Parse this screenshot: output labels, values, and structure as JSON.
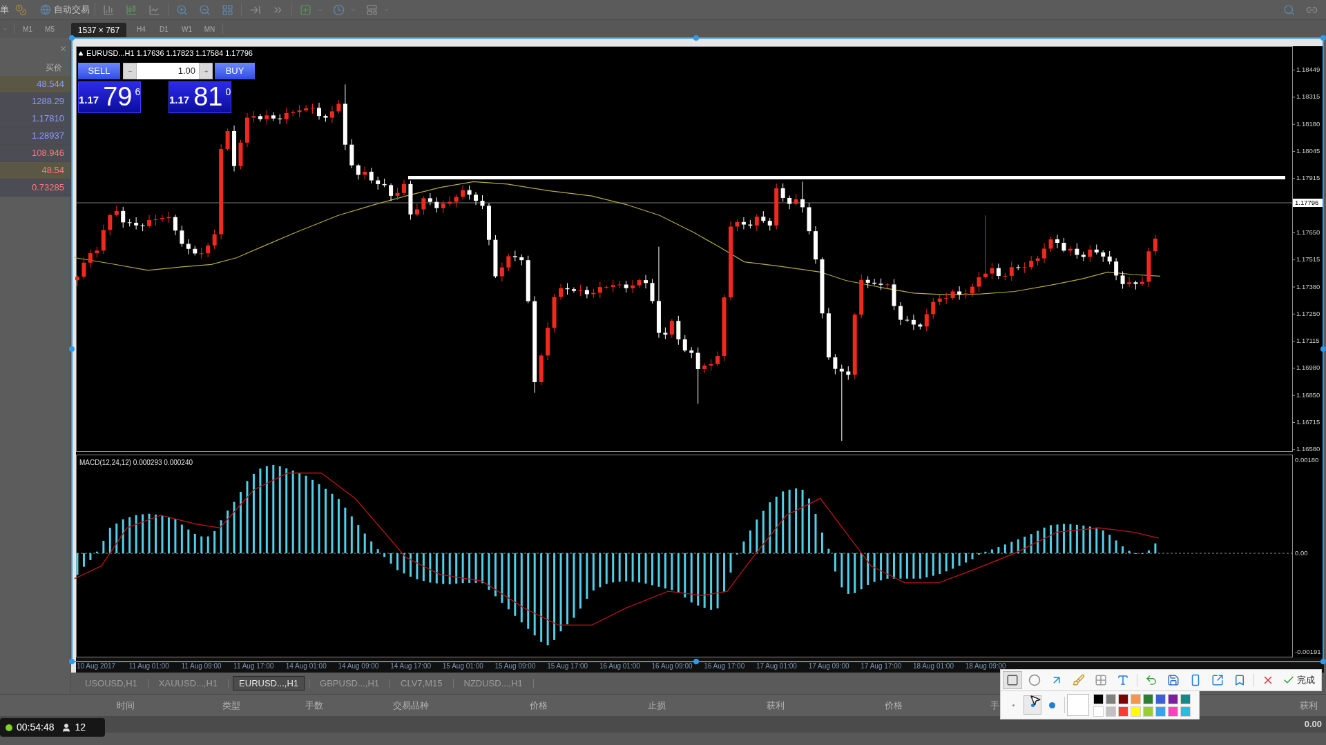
{
  "toolbar": {
    "cut_label": "单",
    "auto_trading": "自动交易"
  },
  "timeframes": [
    "M1",
    "M5",
    "H4",
    "D1",
    "W1",
    "MN"
  ],
  "capture_size": "1537 × 767",
  "market_watch": {
    "header": "买价",
    "rows": [
      {
        "bid": "48.544",
        "color": "#8c9aff",
        "highlighted": true
      },
      {
        "bid": "1288.29",
        "color": "#8c9aff",
        "highlighted": false
      },
      {
        "bid": "1.17810",
        "color": "#8c9aff",
        "highlighted": false
      },
      {
        "bid": "1.28937",
        "color": "#8c9aff",
        "highlighted": false
      },
      {
        "bid": "108.946",
        "color": "#ff7a7a",
        "highlighted": false
      },
      {
        "bid": "48.54",
        "color": "#ff7a7a",
        "highlighted": true
      },
      {
        "bid": "0.73285",
        "color": "#ff7a7a",
        "highlighted": false
      }
    ]
  },
  "chart": {
    "header": "EURUSD...H1 1.17636 1.17823 1.17584 1.17796",
    "trade_panel": {
      "sell": "SELL",
      "lots": "1.00",
      "buy": "BUY",
      "bid": {
        "big": "1.17",
        "pips": "79",
        "point": "6"
      },
      "ask": {
        "big": "1.17",
        "pips": "81",
        "point": "0"
      }
    },
    "price_scale": [
      "1.18449",
      "1.18315",
      "1.18180",
      "1.18045",
      "1.17915",
      "1.17650",
      "1.17515",
      "1.17380",
      "1.17250",
      "1.17115",
      "1.16980",
      "1.16850",
      "1.16715",
      "1.16580"
    ],
    "current_price": "1.17796",
    "indicator": {
      "label": "MACD(12,24,12) 0.000293 0.000240",
      "scale": [
        "0.00180",
        "0.00",
        "-0.00191"
      ]
    },
    "time_labels": [
      "10 Aug 2017",
      "11 Aug 01:00",
      "11 Aug 09:00",
      "11 Aug 17:00",
      "14 Aug 01:00",
      "14 Aug 09:00",
      "14 Aug 17:00",
      "15 Aug 01:00",
      "15 Aug 09:00",
      "15 Aug 17:00",
      "16 Aug 01:00",
      "16 Aug 09:00",
      "16 Aug 17:00",
      "17 Aug 01:00",
      "17 Aug 09:00",
      "17 Aug 17:00",
      "18 Aug 01:00",
      "18 Aug 09:00"
    ]
  },
  "chart_tabs": [
    {
      "label": "USOUSD,H1",
      "selected": false
    },
    {
      "label": "XAUUSD...,H1",
      "selected": false
    },
    {
      "label": "EURUSD...,H1",
      "selected": true
    },
    {
      "label": "GBPUSD...,H1",
      "selected": false
    },
    {
      "label": "CLV7,M15",
      "selected": false
    },
    {
      "label": "NZDUSD...,H1",
      "selected": false
    }
  ],
  "terminal": {
    "columns": [
      "时间",
      "类型",
      "手数",
      "交易品种",
      "价格",
      "止损",
      "获利",
      "价格",
      "手",
      "获利"
    ],
    "total": "0.00"
  },
  "recording": {
    "elapsed": "00:54:48",
    "viewers": "12"
  },
  "capture_toolbar": {
    "draw_tools": [
      {
        "kind": "rectangle",
        "selected": true
      },
      {
        "kind": "ellipse",
        "selected": false
      },
      {
        "kind": "arrow",
        "selected": false
      },
      {
        "kind": "pen",
        "selected": false
      },
      {
        "kind": "mosaic",
        "selected": false
      },
      {
        "kind": "text",
        "selected": false
      }
    ],
    "done": "完成",
    "sizes": [
      {
        "kind": "small",
        "selected": false
      },
      {
        "kind": "medium",
        "selected": true
      },
      {
        "kind": "large",
        "selected": false
      }
    ],
    "current": {
      "color": "#ffffff"
    },
    "palette": [
      {
        "color": "#000000"
      },
      {
        "color": "#808080"
      },
      {
        "color": "#800000"
      },
      {
        "color": "#f79646"
      },
      {
        "color": "#2e7d32"
      },
      {
        "color": "#3a5fd8"
      },
      {
        "color": "#7b1fa2"
      },
      {
        "color": "#138a8a"
      },
      {
        "color": "#ffffff"
      },
      {
        "color": "#c0c0c0"
      },
      {
        "color": "#ff3b30"
      },
      {
        "color": "#ffff00"
      },
      {
        "color": "#9acd32"
      },
      {
        "color": "#3ba0f0"
      },
      {
        "color": "#ff40c0"
      },
      {
        "color": "#20c0e0"
      }
    ]
  }
}
